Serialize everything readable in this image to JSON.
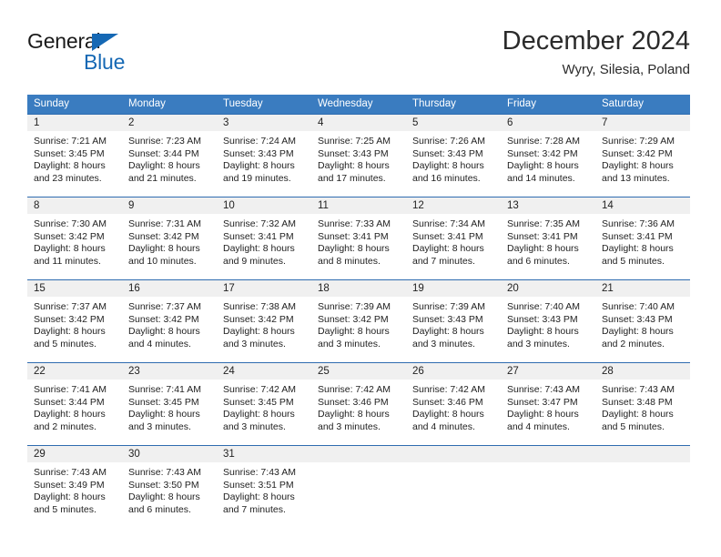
{
  "brand": {
    "name_part1": "General",
    "name_part2": "Blue",
    "flag_icon": "triangle-flag-icon"
  },
  "header": {
    "title": "December 2024",
    "location": "Wyry, Silesia, Poland"
  },
  "colors": {
    "header_blue": "#3a7cc0",
    "grid_line_blue": "#2f6cb0",
    "daynum_band": "#f0f0f0",
    "brand_blue": "#1568b4",
    "text": "#222222"
  },
  "calendar": {
    "day_headers": [
      "Sunday",
      "Monday",
      "Tuesday",
      "Wednesday",
      "Thursday",
      "Friday",
      "Saturday"
    ],
    "weeks": [
      [
        {
          "day": "1",
          "sunrise": "Sunrise: 7:21 AM",
          "sunset": "Sunset: 3:45 PM",
          "daylight_line1": "Daylight: 8 hours",
          "daylight_line2": "and 23 minutes."
        },
        {
          "day": "2",
          "sunrise": "Sunrise: 7:23 AM",
          "sunset": "Sunset: 3:44 PM",
          "daylight_line1": "Daylight: 8 hours",
          "daylight_line2": "and 21 minutes."
        },
        {
          "day": "3",
          "sunrise": "Sunrise: 7:24 AM",
          "sunset": "Sunset: 3:43 PM",
          "daylight_line1": "Daylight: 8 hours",
          "daylight_line2": "and 19 minutes."
        },
        {
          "day": "4",
          "sunrise": "Sunrise: 7:25 AM",
          "sunset": "Sunset: 3:43 PM",
          "daylight_line1": "Daylight: 8 hours",
          "daylight_line2": "and 17 minutes."
        },
        {
          "day": "5",
          "sunrise": "Sunrise: 7:26 AM",
          "sunset": "Sunset: 3:43 PM",
          "daylight_line1": "Daylight: 8 hours",
          "daylight_line2": "and 16 minutes."
        },
        {
          "day": "6",
          "sunrise": "Sunrise: 7:28 AM",
          "sunset": "Sunset: 3:42 PM",
          "daylight_line1": "Daylight: 8 hours",
          "daylight_line2": "and 14 minutes."
        },
        {
          "day": "7",
          "sunrise": "Sunrise: 7:29 AM",
          "sunset": "Sunset: 3:42 PM",
          "daylight_line1": "Daylight: 8 hours",
          "daylight_line2": "and 13 minutes."
        }
      ],
      [
        {
          "day": "8",
          "sunrise": "Sunrise: 7:30 AM",
          "sunset": "Sunset: 3:42 PM",
          "daylight_line1": "Daylight: 8 hours",
          "daylight_line2": "and 11 minutes."
        },
        {
          "day": "9",
          "sunrise": "Sunrise: 7:31 AM",
          "sunset": "Sunset: 3:42 PM",
          "daylight_line1": "Daylight: 8 hours",
          "daylight_line2": "and 10 minutes."
        },
        {
          "day": "10",
          "sunrise": "Sunrise: 7:32 AM",
          "sunset": "Sunset: 3:41 PM",
          "daylight_line1": "Daylight: 8 hours",
          "daylight_line2": "and 9 minutes."
        },
        {
          "day": "11",
          "sunrise": "Sunrise: 7:33 AM",
          "sunset": "Sunset: 3:41 PM",
          "daylight_line1": "Daylight: 8 hours",
          "daylight_line2": "and 8 minutes."
        },
        {
          "day": "12",
          "sunrise": "Sunrise: 7:34 AM",
          "sunset": "Sunset: 3:41 PM",
          "daylight_line1": "Daylight: 8 hours",
          "daylight_line2": "and 7 minutes."
        },
        {
          "day": "13",
          "sunrise": "Sunrise: 7:35 AM",
          "sunset": "Sunset: 3:41 PM",
          "daylight_line1": "Daylight: 8 hours",
          "daylight_line2": "and 6 minutes."
        },
        {
          "day": "14",
          "sunrise": "Sunrise: 7:36 AM",
          "sunset": "Sunset: 3:41 PM",
          "daylight_line1": "Daylight: 8 hours",
          "daylight_line2": "and 5 minutes."
        }
      ],
      [
        {
          "day": "15",
          "sunrise": "Sunrise: 7:37 AM",
          "sunset": "Sunset: 3:42 PM",
          "daylight_line1": "Daylight: 8 hours",
          "daylight_line2": "and 5 minutes."
        },
        {
          "day": "16",
          "sunrise": "Sunrise: 7:37 AM",
          "sunset": "Sunset: 3:42 PM",
          "daylight_line1": "Daylight: 8 hours",
          "daylight_line2": "and 4 minutes."
        },
        {
          "day": "17",
          "sunrise": "Sunrise: 7:38 AM",
          "sunset": "Sunset: 3:42 PM",
          "daylight_line1": "Daylight: 8 hours",
          "daylight_line2": "and 3 minutes."
        },
        {
          "day": "18",
          "sunrise": "Sunrise: 7:39 AM",
          "sunset": "Sunset: 3:42 PM",
          "daylight_line1": "Daylight: 8 hours",
          "daylight_line2": "and 3 minutes."
        },
        {
          "day": "19",
          "sunrise": "Sunrise: 7:39 AM",
          "sunset": "Sunset: 3:43 PM",
          "daylight_line1": "Daylight: 8 hours",
          "daylight_line2": "and 3 minutes."
        },
        {
          "day": "20",
          "sunrise": "Sunrise: 7:40 AM",
          "sunset": "Sunset: 3:43 PM",
          "daylight_line1": "Daylight: 8 hours",
          "daylight_line2": "and 3 minutes."
        },
        {
          "day": "21",
          "sunrise": "Sunrise: 7:40 AM",
          "sunset": "Sunset: 3:43 PM",
          "daylight_line1": "Daylight: 8 hours",
          "daylight_line2": "and 2 minutes."
        }
      ],
      [
        {
          "day": "22",
          "sunrise": "Sunrise: 7:41 AM",
          "sunset": "Sunset: 3:44 PM",
          "daylight_line1": "Daylight: 8 hours",
          "daylight_line2": "and 2 minutes."
        },
        {
          "day": "23",
          "sunrise": "Sunrise: 7:41 AM",
          "sunset": "Sunset: 3:45 PM",
          "daylight_line1": "Daylight: 8 hours",
          "daylight_line2": "and 3 minutes."
        },
        {
          "day": "24",
          "sunrise": "Sunrise: 7:42 AM",
          "sunset": "Sunset: 3:45 PM",
          "daylight_line1": "Daylight: 8 hours",
          "daylight_line2": "and 3 minutes."
        },
        {
          "day": "25",
          "sunrise": "Sunrise: 7:42 AM",
          "sunset": "Sunset: 3:46 PM",
          "daylight_line1": "Daylight: 8 hours",
          "daylight_line2": "and 3 minutes."
        },
        {
          "day": "26",
          "sunrise": "Sunrise: 7:42 AM",
          "sunset": "Sunset: 3:46 PM",
          "daylight_line1": "Daylight: 8 hours",
          "daylight_line2": "and 4 minutes."
        },
        {
          "day": "27",
          "sunrise": "Sunrise: 7:43 AM",
          "sunset": "Sunset: 3:47 PM",
          "daylight_line1": "Daylight: 8 hours",
          "daylight_line2": "and 4 minutes."
        },
        {
          "day": "28",
          "sunrise": "Sunrise: 7:43 AM",
          "sunset": "Sunset: 3:48 PM",
          "daylight_line1": "Daylight: 8 hours",
          "daylight_line2": "and 5 minutes."
        }
      ],
      [
        {
          "day": "29",
          "sunrise": "Sunrise: 7:43 AM",
          "sunset": "Sunset: 3:49 PM",
          "daylight_line1": "Daylight: 8 hours",
          "daylight_line2": "and 5 minutes."
        },
        {
          "day": "30",
          "sunrise": "Sunrise: 7:43 AM",
          "sunset": "Sunset: 3:50 PM",
          "daylight_line1": "Daylight: 8 hours",
          "daylight_line2": "and 6 minutes."
        },
        {
          "day": "31",
          "sunrise": "Sunrise: 7:43 AM",
          "sunset": "Sunset: 3:51 PM",
          "daylight_line1": "Daylight: 8 hours",
          "daylight_line2": "and 7 minutes."
        },
        {
          "day": "",
          "sunrise": "",
          "sunset": "",
          "daylight_line1": "",
          "daylight_line2": ""
        },
        {
          "day": "",
          "sunrise": "",
          "sunset": "",
          "daylight_line1": "",
          "daylight_line2": ""
        },
        {
          "day": "",
          "sunrise": "",
          "sunset": "",
          "daylight_line1": "",
          "daylight_line2": ""
        },
        {
          "day": "",
          "sunrise": "",
          "sunset": "",
          "daylight_line1": "",
          "daylight_line2": ""
        }
      ]
    ]
  }
}
